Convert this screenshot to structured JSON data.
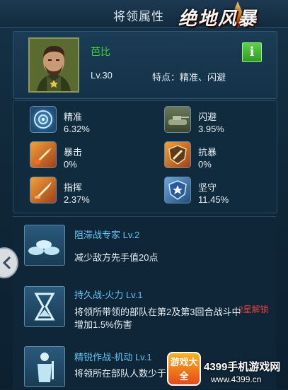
{
  "window": {
    "title": "将领属性"
  },
  "logo": {
    "text": "绝地风暴"
  },
  "hero": {
    "name": "芭比",
    "level": "Lv.30",
    "traits": "特点：精准、闪避",
    "info_label": "i"
  },
  "stats": [
    {
      "name": "精准",
      "value": "6.32%",
      "icon": "precision-reticle-icon"
    },
    {
      "name": "闪避",
      "value": "3.95%",
      "icon": "tank-icon"
    },
    {
      "name": "暴击",
      "value": "0%",
      "icon": "critical-missile-icon"
    },
    {
      "name": "抗暴",
      "value": "0%",
      "icon": "shield-slash-icon"
    },
    {
      "name": "指挥",
      "value": "2.37%",
      "icon": "command-shell-icon"
    },
    {
      "name": "坚守",
      "value": "11.45%",
      "icon": "star-shield-icon"
    }
  ],
  "skills": [
    {
      "name": "阻滞战专家 Lv.2",
      "desc": "减少敌方先手值20点",
      "icon": "sandbag-icon"
    },
    {
      "name": "持久战-火力 Lv.1",
      "desc": "将领所带领的部队在第2及第3回合战斗中增加1.5%伤害",
      "icon": "hourglass-icon"
    },
    {
      "name": "精锐作战-机动 Lv.1",
      "desc": "将领所在部队人数少于...%闪避",
      "icon": "soldier-icon"
    }
  ],
  "unlock_text": "2星解锁",
  "watermark": {
    "badge": "游戏大全",
    "line1": "4399手机游戏网",
    "line2": "www.4399.cn"
  },
  "colors": {
    "accent_green": "#3fd13f",
    "skill_name": "#5fc6f4",
    "unlock_red": "#e84040"
  }
}
